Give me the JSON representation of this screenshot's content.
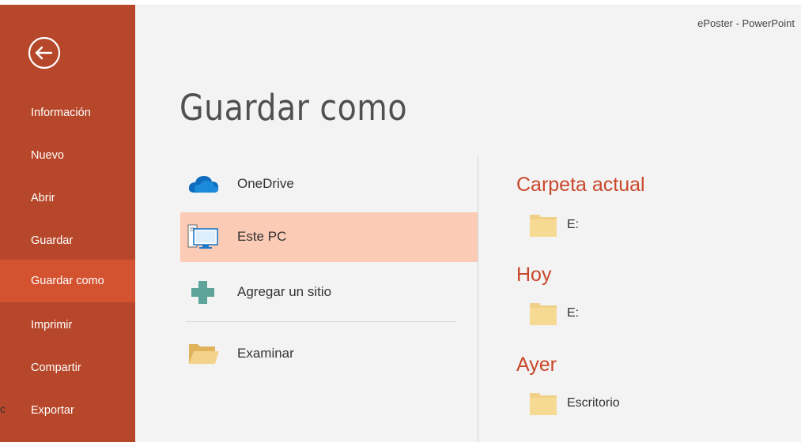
{
  "window": {
    "title": "ePoster - PowerPoint"
  },
  "sidebar": {
    "items": [
      {
        "label": "Información"
      },
      {
        "label": "Nuevo"
      },
      {
        "label": "Abrir"
      },
      {
        "label": "Guardar"
      },
      {
        "label": "Guardar como",
        "selected": true
      },
      {
        "label": "Imprimir"
      },
      {
        "label": "Compartir"
      },
      {
        "label": "Exportar"
      }
    ],
    "icons": {
      "back": "back-arrow-circle-icon"
    },
    "stray_char": "c"
  },
  "main": {
    "title": "Guardar como",
    "locations": [
      {
        "label": "OneDrive",
        "icon": "onedrive-cloud-icon"
      },
      {
        "label": "Este PC",
        "icon": "computer-icon",
        "selected": true
      },
      {
        "label": "Agregar un sitio",
        "icon": "plus-icon"
      },
      {
        "label": "Examinar",
        "icon": "open-folder-icon"
      }
    ],
    "sections": [
      {
        "heading": "Carpeta actual",
        "folders": [
          {
            "name": "E:"
          }
        ]
      },
      {
        "heading": "Hoy",
        "folders": [
          {
            "name": "E:"
          }
        ]
      },
      {
        "heading": "Ayer",
        "folders": [
          {
            "name": "Escritorio"
          }
        ]
      }
    ]
  },
  "colors": {
    "rail": "#b7472a",
    "rail_selected": "#d35230",
    "location_selected": "#fbcbb5",
    "section_heading": "#c9472a",
    "folder": "#f0cf86"
  }
}
